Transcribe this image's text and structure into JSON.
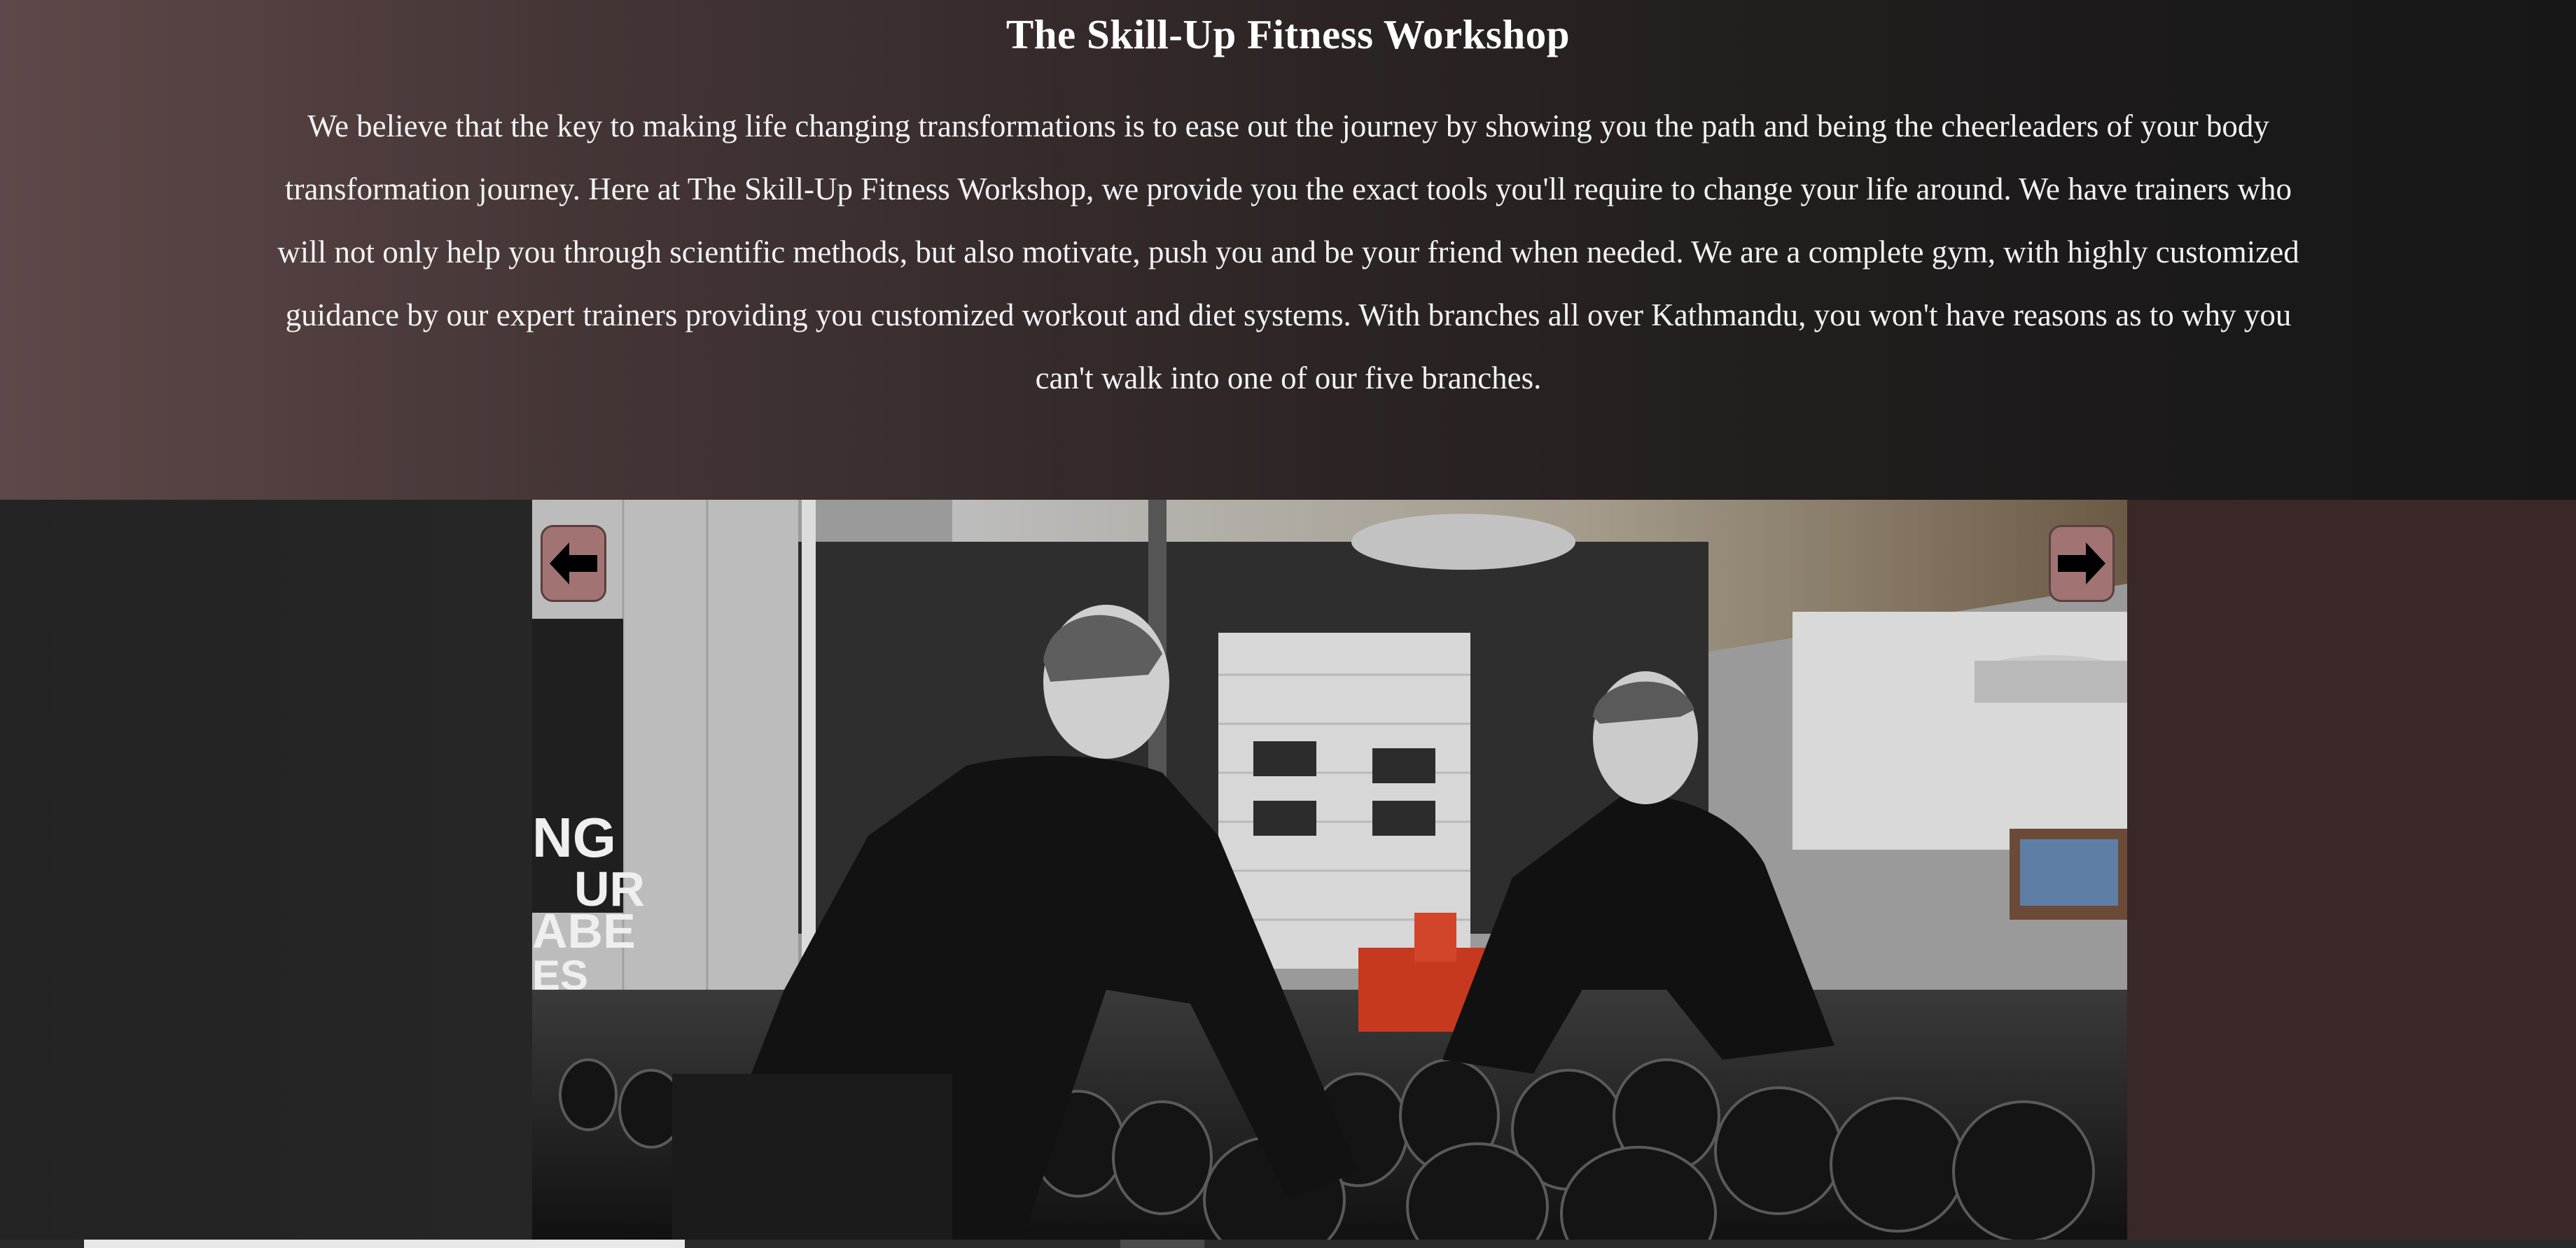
{
  "about": {
    "title": "The Skill-Up Fitness Workshop",
    "body": "We believe that the key to making life changing transformations is to ease out the journey by showing you the path and being the cheerleaders of your body transformation journey. Here at The Skill-Up Fitness Workshop, we provide you the exact tools you'll require to change your life around. We have trainers who will not only help you through scientific methods, but also motivate, push you and be your friend when needed. We are a complete gym, with highly customized guidance by our expert trainers providing you customized workout and diet systems. With branches all over Kathmandu, you won't have reasons as to why you can't walk into one of our five branches."
  },
  "carousel": {
    "mirror_text": [
      "NG",
      "UR",
      "ABE",
      "ES"
    ],
    "prev_icon": "arrow-left-icon",
    "next_icon": "arrow-right-icon"
  },
  "colors": {
    "header_gradient_start": "#5f4849",
    "header_gradient_end": "#171717",
    "arrow_button": "#a27373",
    "right_panel": "#3a2727",
    "left_panel": "#232323"
  }
}
